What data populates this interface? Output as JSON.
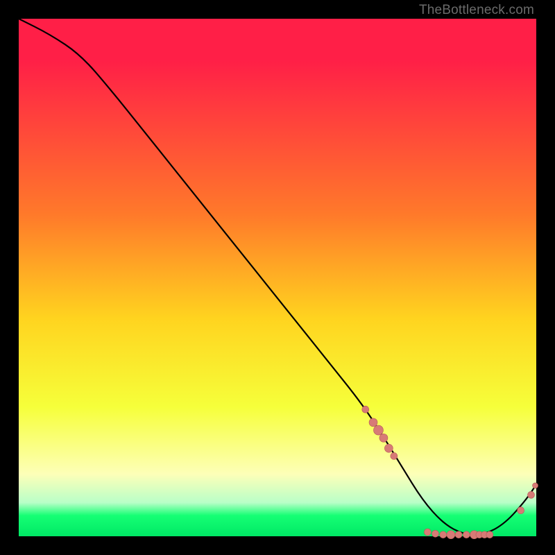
{
  "attribution": "TheBottleneck.com",
  "colors": {
    "top": "#ff1f47",
    "mid_upper": "#ff7a2a",
    "mid": "#ffd41f",
    "mid_lower": "#f6ff3a",
    "pale_yellow": "#fdffb8",
    "green_band_light": "#b9ffc8",
    "green": "#15ff74",
    "green_bottom": "#00e865",
    "curve": "#000000",
    "marker": "#d77a76",
    "marker_edge": "#b55b56"
  },
  "chart_data": {
    "type": "line",
    "title": "",
    "xlabel": "",
    "ylabel": "",
    "xlim": [
      0,
      100
    ],
    "ylim": [
      0,
      100
    ],
    "series": [
      {
        "name": "bottleneck-curve",
        "x": [
          0,
          6,
          12,
          18,
          24,
          30,
          36,
          42,
          48,
          54,
          60,
          66,
          70,
          74,
          78,
          82,
          86,
          90,
          94,
          98,
          100
        ],
        "y": [
          100,
          97,
          93,
          86,
          78.5,
          71,
          63.5,
          56,
          48.5,
          41,
          33.5,
          26,
          20,
          13.5,
          7,
          2.5,
          0.3,
          0.3,
          2.5,
          7,
          10
        ]
      }
    ],
    "markers": [
      {
        "x": 67.0,
        "y": 24.5,
        "r": 5
      },
      {
        "x": 68.5,
        "y": 22.0,
        "r": 6
      },
      {
        "x": 69.5,
        "y": 20.5,
        "r": 7
      },
      {
        "x": 70.5,
        "y": 19.0,
        "r": 6
      },
      {
        "x": 71.5,
        "y": 17.0,
        "r": 6
      },
      {
        "x": 72.5,
        "y": 15.5,
        "r": 5
      },
      {
        "x": 79.0,
        "y": 0.8,
        "r": 5
      },
      {
        "x": 80.5,
        "y": 0.5,
        "r": 5
      },
      {
        "x": 82.0,
        "y": 0.3,
        "r": 5
      },
      {
        "x": 83.5,
        "y": 0.3,
        "r": 6
      },
      {
        "x": 85.0,
        "y": 0.3,
        "r": 5
      },
      {
        "x": 86.5,
        "y": 0.3,
        "r": 5
      },
      {
        "x": 88.0,
        "y": 0.3,
        "r": 6
      },
      {
        "x": 89.0,
        "y": 0.3,
        "r": 5
      },
      {
        "x": 90.0,
        "y": 0.3,
        "r": 5
      },
      {
        "x": 91.0,
        "y": 0.3,
        "r": 5
      },
      {
        "x": 97.0,
        "y": 5.0,
        "r": 5
      },
      {
        "x": 99.0,
        "y": 8.0,
        "r": 5
      },
      {
        "x": 99.8,
        "y": 9.8,
        "r": 4
      }
    ],
    "gradient_stops": [
      {
        "offset": 0,
        "key": "top"
      },
      {
        "offset": 8,
        "key": "top"
      },
      {
        "offset": 38,
        "key": "mid_upper"
      },
      {
        "offset": 58,
        "key": "mid"
      },
      {
        "offset": 75,
        "key": "mid_lower"
      },
      {
        "offset": 88,
        "key": "pale_yellow"
      },
      {
        "offset": 93.5,
        "key": "green_band_light"
      },
      {
        "offset": 96,
        "key": "green"
      },
      {
        "offset": 100,
        "key": "green_bottom"
      }
    ]
  }
}
